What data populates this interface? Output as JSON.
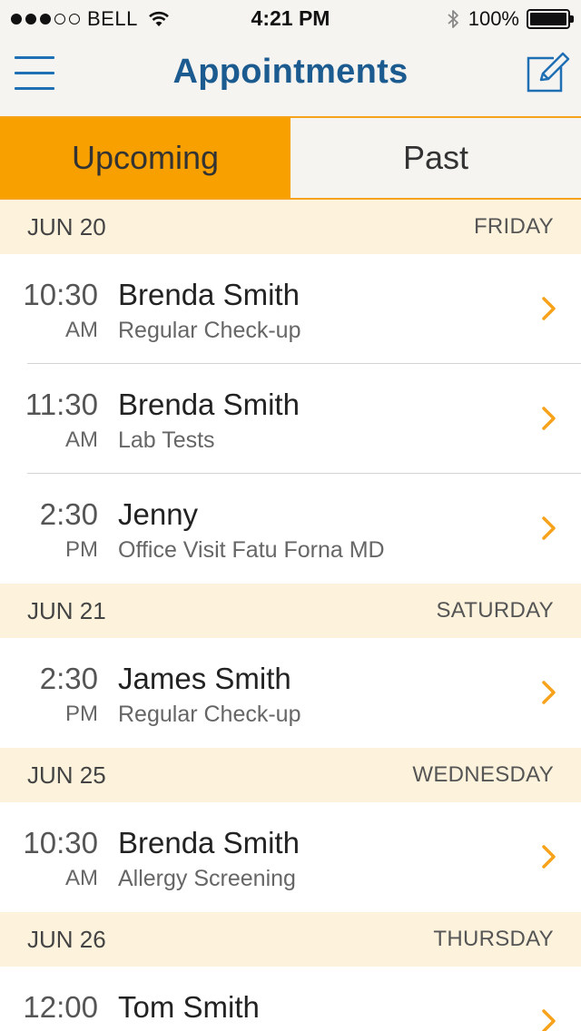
{
  "status_bar": {
    "signal_filled": 3,
    "signal_empty": 2,
    "carrier": "BELL",
    "time": "4:21 PM",
    "battery": "100%"
  },
  "nav": {
    "title": "Appointments",
    "menu_icon": "hamburger-menu-icon",
    "compose_icon": "compose-icon"
  },
  "tabs": [
    {
      "label": "Upcoming",
      "active": true
    },
    {
      "label": "Past",
      "active": false
    }
  ],
  "colors": {
    "accent": "#f7a000",
    "title": "#1c5b90",
    "icon_blue": "#1f6fb4",
    "header_bg": "#fdf3dd",
    "chevron": "#f7a21b"
  },
  "days": [
    {
      "date": "JUN 20",
      "weekday": "FRIDAY",
      "appointments": [
        {
          "time": "10:30",
          "ampm": "AM",
          "name": "Brenda Smith",
          "type": "Regular Check-up"
        },
        {
          "time": "11:30",
          "ampm": "AM",
          "name": "Brenda Smith",
          "type": "Lab Tests"
        },
        {
          "time": "2:30",
          "ampm": "PM",
          "name": "Jenny",
          "type": "Office Visit Fatu Forna MD"
        }
      ]
    },
    {
      "date": "JUN 21",
      "weekday": "SATURDAY",
      "appointments": [
        {
          "time": "2:30",
          "ampm": "PM",
          "name": "James Smith",
          "type": "Regular Check-up"
        }
      ]
    },
    {
      "date": "JUN 25",
      "weekday": "WEDNESDAY",
      "appointments": [
        {
          "time": "10:30",
          "ampm": "AM",
          "name": "Brenda Smith",
          "type": "Allergy Screening"
        }
      ]
    },
    {
      "date": "JUN 26",
      "weekday": "THURSDAY",
      "appointments": [
        {
          "time": "12:00",
          "ampm": "",
          "name": "Tom Smith",
          "type": ""
        }
      ]
    }
  ]
}
